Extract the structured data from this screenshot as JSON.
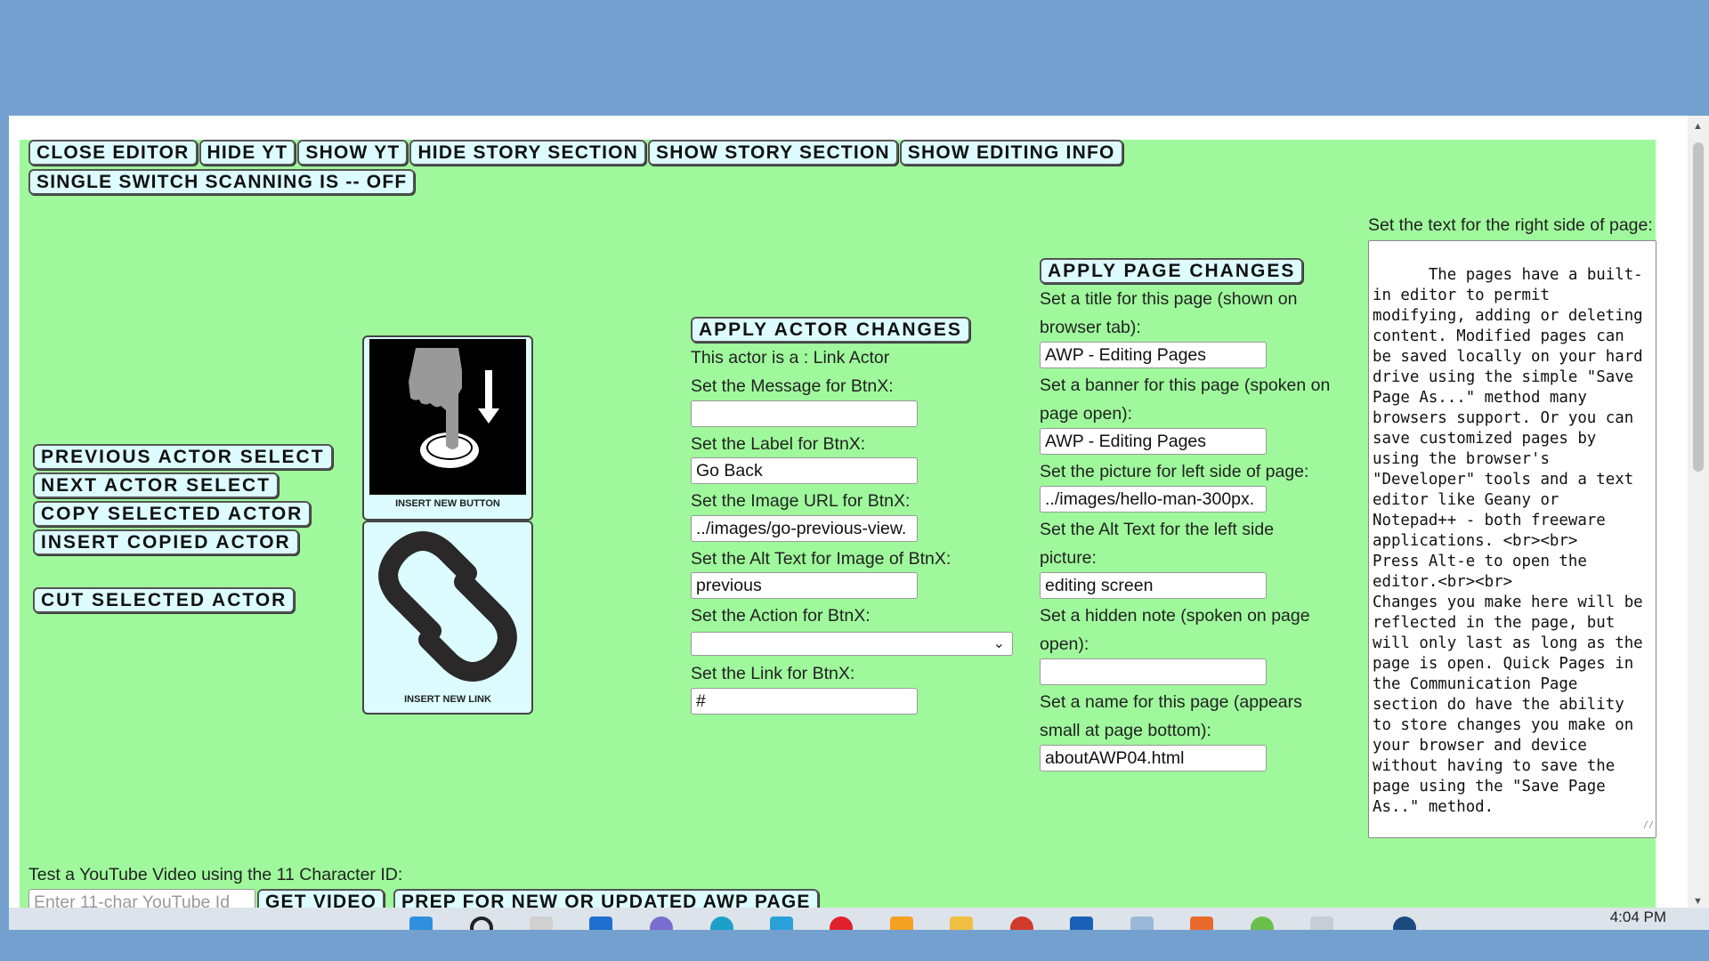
{
  "toolbar": {
    "buttons": [
      {
        "label": "CLOSE EDITOR"
      },
      {
        "label": "HIDE YT"
      },
      {
        "label": "SHOW YT"
      },
      {
        "label": "HIDE STORY SECTION"
      },
      {
        "label": "SHOW STORY SECTION"
      },
      {
        "label": "SHOW EDITING INFO"
      }
    ],
    "scanning_label": "SINGLE SWITCH SCANNING IS -- OFF"
  },
  "actor_nav": {
    "previous": "PREVIOUS ACTOR SELECT",
    "next": "NEXT ACTOR SELECT",
    "copy": "COPY SELECTED ACTOR",
    "insert_copied": "INSERT COPIED ACTOR",
    "cut": "CUT SELECTED ACTOR"
  },
  "tiles": {
    "insert_button": "INSERT NEW BUTTON",
    "insert_link": "INSERT NEW LINK"
  },
  "actor_panel": {
    "apply_label": "APPLY ACTOR CHANGES",
    "actor_type": "This actor is a : Link Actor",
    "message_label": "Set the Message for BtnX:",
    "message_value": "",
    "btn_label_label": "Set the Label for BtnX:",
    "btn_label_value": "Go Back",
    "image_url_label": "Set the Image URL for BtnX:",
    "image_url_value": "../images/go-previous-view.",
    "alt_label": "Set the Alt Text for Image of BtnX:",
    "alt_value": "previous",
    "action_label": "Set the Action for BtnX:",
    "action_value": "",
    "link_label": "Set the Link for BtnX:",
    "link_value": "#"
  },
  "page_panel": {
    "apply_label": "APPLY PAGE CHANGES",
    "title_label_1": "Set a title for this page (shown on",
    "title_label_2": "browser tab):",
    "title_value": "AWP - Editing Pages",
    "banner_label_1": "Set a banner for this page (spoken on",
    "banner_label_2": "page open):",
    "banner_value": "AWP - Editing Pages",
    "picture_label": "Set the picture for left side of page:",
    "picture_value": "../images/hello-man-300px.",
    "alt_label_1": "Set the Alt Text for the left side",
    "alt_label_2": "picture:",
    "alt_value": "editing screen",
    "note_label_1": "Set a hidden note (spoken on page",
    "note_label_2": "open):",
    "note_value": "",
    "name_label_1": "Set a name for this page (appears",
    "name_label_2": "small at page bottom):",
    "name_value": "aboutAWP04.html"
  },
  "right_text": {
    "label": "Set the text for the right side of page:",
    "value": "The pages have a built-in editor to permit modifying, adding or deleting content. Modified pages can be saved locally on your hard drive using the simple \"Save Page As...\" method many browsers support. Or you can save customized pages by using the browser's \"Developer\" tools and a text editor like Geany or Notepad++ - both freeware applications. <br><br>\nPress Alt-e to open the editor.<br><br>\nChanges you make here will be reflected in the page, but will only last as long as the page is open. Quick Pages in the Communication Page section do have the ability to store changes you make on your browser and device without having to save the page using the \"Save Page As..\" method."
  },
  "youtube": {
    "label": "Test a YouTube Video using the 11 Character ID:",
    "placeholder": "Enter 11-char YouTube Id",
    "get_video": "GET VIDEO",
    "prep": "PREP FOR NEW OR UPDATED AWP PAGE"
  },
  "taskbar": {
    "clock": "4:04 PM"
  }
}
